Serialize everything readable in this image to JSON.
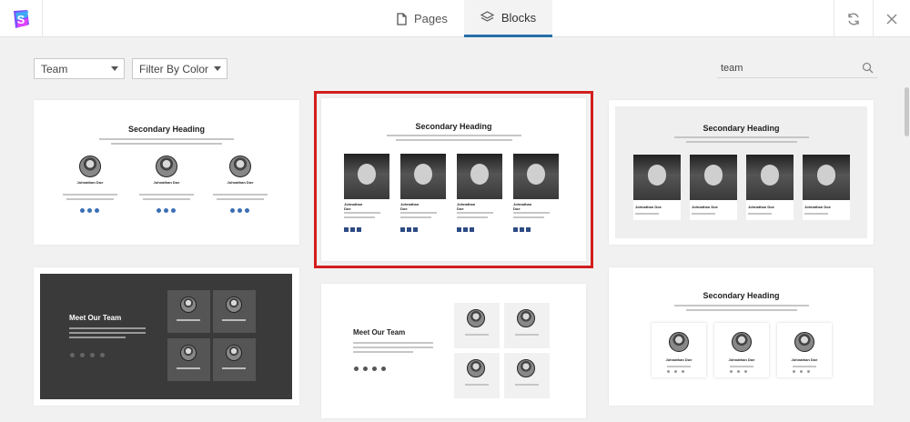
{
  "nav": {
    "tabs": [
      {
        "label": "Pages",
        "icon": "document-icon"
      },
      {
        "label": "Blocks",
        "icon": "layers-icon",
        "active": true
      }
    ]
  },
  "filters": {
    "category": "Team",
    "color": "Filter By Color",
    "search_value": "team"
  },
  "cards": {
    "heading": "Secondary Heading",
    "meet_title": "Meet Our Team",
    "member_name": "Johnathan Doe"
  },
  "colors": {
    "accent": "#2470a8",
    "selection": "#d21e1e"
  }
}
